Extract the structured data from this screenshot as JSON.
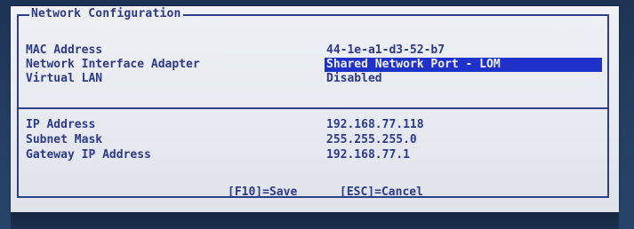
{
  "frame": {
    "title": "Network Configuration"
  },
  "fields": [
    {
      "label": "MAC Address",
      "value": "44-1e-a1-d3-52-b7"
    },
    {
      "label": "Network Interface Adapter",
      "value": "Shared Network Port - LOM"
    },
    {
      "label": "Virtual LAN",
      "value": "Disabled"
    },
    {
      "label": "IP Address",
      "value": "192.168.77.118"
    },
    {
      "label": "Subnet Mask",
      "value": "255.255.255.0"
    },
    {
      "label": "Gateway IP Address",
      "value": "192.168.77.1"
    }
  ],
  "footer": {
    "save": "[F10]=Save",
    "cancel": "[ESC]=Cancel"
  },
  "colors": {
    "text": "#2c3a8c",
    "highlight": "#1f31c8",
    "panel": "#eceef2",
    "background": "#1f3556"
  }
}
